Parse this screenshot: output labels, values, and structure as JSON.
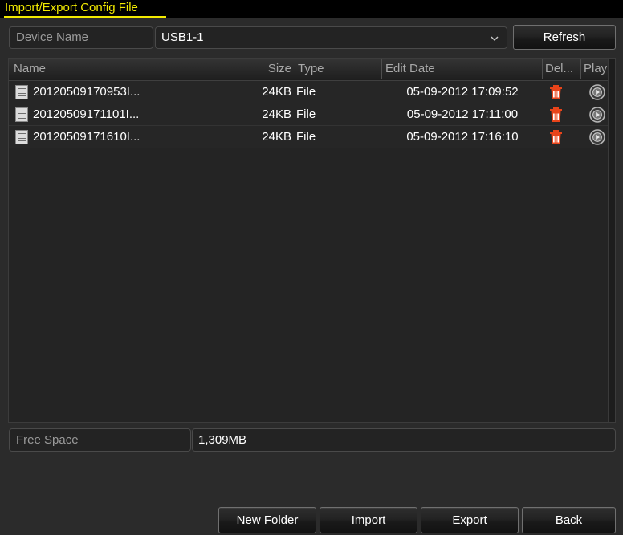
{
  "window": {
    "title": "Import/Export Config File"
  },
  "device": {
    "label": "Device Name",
    "selected": "USB1-1",
    "dropdown_icon": "chevron-down-icon",
    "refresh_label": "Refresh"
  },
  "file_list": {
    "columns": [
      {
        "key": "name",
        "label": "Name"
      },
      {
        "key": "size",
        "label": "Size"
      },
      {
        "key": "type",
        "label": "Type"
      },
      {
        "key": "date",
        "label": "Edit Date"
      },
      {
        "key": "del",
        "label": "Del..."
      },
      {
        "key": "play",
        "label": "Play"
      }
    ],
    "rows": [
      {
        "icon": "file-icon",
        "name": "20120509170953I...",
        "size": "24KB",
        "type": "File",
        "date": "05-09-2012 17:09:52",
        "delete_icon": "trash-icon",
        "play_icon": "play-circle-icon"
      },
      {
        "icon": "file-icon",
        "name": "20120509171101I...",
        "size": "24KB",
        "type": "File",
        "date": "05-09-2012 17:11:00",
        "delete_icon": "trash-icon",
        "play_icon": "play-circle-icon"
      },
      {
        "icon": "file-icon",
        "name": "20120509171610I...",
        "size": "24KB",
        "type": "File",
        "date": "05-09-2012 17:16:10",
        "delete_icon": "trash-icon",
        "play_icon": "play-circle-icon"
      }
    ]
  },
  "free_space": {
    "label": "Free Space",
    "value": "1,309MB"
  },
  "footer": {
    "new_folder_label": "New Folder",
    "import_label": "Import",
    "export_label": "Export",
    "back_label": "Back"
  },
  "colors": {
    "title_yellow": "#f2ea00",
    "page_background": "#2b2b2b",
    "list_background": "#242424",
    "delete_red": "#e8441a",
    "label_gray": "#9a9a9a"
  }
}
